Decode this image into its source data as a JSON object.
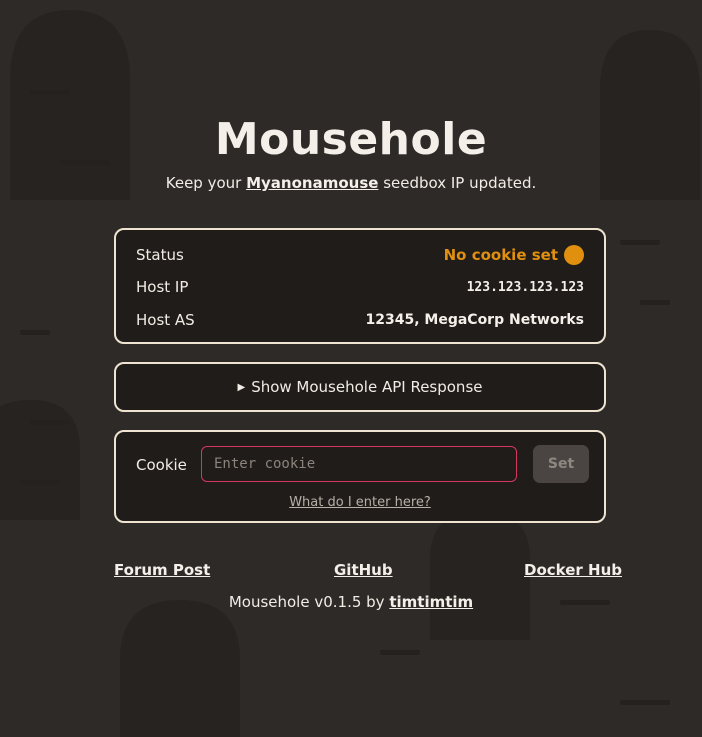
{
  "header": {
    "title": "Mousehole",
    "tagline_before": "Keep your ",
    "tagline_link": "Myanonamouse",
    "tagline_after": " seedbox IP updated."
  },
  "status_card": {
    "status_label": "Status",
    "status_value": "No cookie set",
    "status_color": "#e0900e",
    "host_ip_label": "Host IP",
    "host_ip_value": "123.123.123.123",
    "host_as_label": "Host AS",
    "host_as_value": "12345, MegaCorp Networks"
  },
  "api": {
    "toggle_label": "Show Mousehole API Response",
    "arrow": "▶"
  },
  "cookie_form": {
    "label": "Cookie",
    "placeholder": "Enter cookie",
    "set_label": "Set",
    "help_link": "What do I enter here?"
  },
  "footer": {
    "forum_post": "Forum Post",
    "github": "GitHub",
    "docker_hub": "Docker Hub",
    "credits_before": "Mousehole v0.1.5 by ",
    "credits_author": "timtimtim"
  },
  "colors": {
    "background": "#2d2a28",
    "card_background": "#1f1c1a",
    "card_border": "#efe4d0",
    "input_border": "#d6365c"
  }
}
